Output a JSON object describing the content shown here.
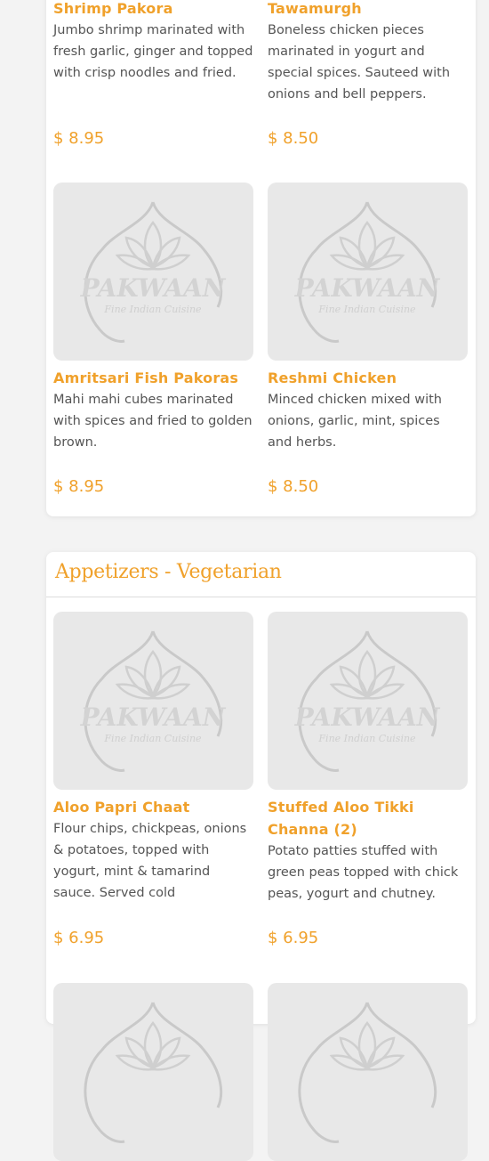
{
  "brand": {
    "logo_text": "PAKWAAN",
    "logo_subtext": "Fine Indian Cuisine",
    "accent_color": "#f0a12b"
  },
  "sections": [
    {
      "title": "",
      "items": [
        {
          "name": "Shrimp Pakora",
          "desc": "Jumbo shrimp marinated with fresh garlic, ginger and topped with crisp noodles and fried.",
          "price": "$ 8.95"
        },
        {
          "name": "Tawamurgh",
          "desc": "Boneless chicken pieces marinated in yogurt and special spices. Sauteed with onions and bell peppers.",
          "price": "$ 8.50"
        },
        {
          "name": "Amritsari Fish Pakoras",
          "desc": "Mahi mahi cubes marinated with spices and fried to golden brown.",
          "price": "$ 8.95"
        },
        {
          "name": "Reshmi Chicken",
          "desc": "Minced chicken mixed with onions, garlic, mint, spices and herbs.",
          "price": "$ 8.50"
        }
      ]
    },
    {
      "title": "Appetizers - Vegetarian",
      "items": [
        {
          "name": "Aloo Papri Chaat",
          "desc": "Flour chips, chickpeas, onions & potatoes, topped with yogurt, mint & tamarind sauce. Served cold",
          "price": "$ 6.95"
        },
        {
          "name": "Stuffed Aloo Tikki Channa (2)",
          "desc": "Potato patties stuffed with green peas topped with chick peas, yogurt and chutney.",
          "price": "$ 6.95"
        }
      ]
    }
  ]
}
